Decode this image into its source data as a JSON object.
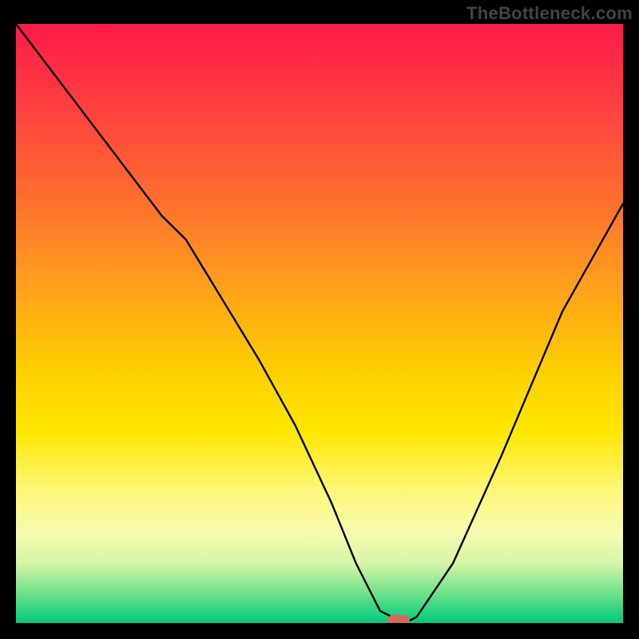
{
  "watermark": "TheBottleneck.com",
  "colors": {
    "background": "#000000",
    "pill": "#d66a5a",
    "curve": "#000000",
    "watermark_text": "#444444"
  },
  "chart_data": {
    "type": "line",
    "title": "",
    "xlabel": "",
    "ylabel": "",
    "xlim": [
      0,
      100
    ],
    "ylim": [
      0,
      100
    ],
    "grid": false,
    "legend": false,
    "series": [
      {
        "name": "bottleneck-curve",
        "x": [
          0,
          6,
          12,
          18,
          24,
          28,
          34,
          40,
          46,
          52,
          56,
          60,
          62,
          64,
          66,
          72,
          80,
          90,
          100
        ],
        "y": [
          100,
          92,
          84,
          76,
          68,
          64,
          54,
          44,
          33,
          20,
          10,
          2,
          1,
          0,
          1,
          10,
          28,
          52,
          70
        ]
      }
    ],
    "marker": {
      "x": 63,
      "y": 0,
      "shape": "pill"
    }
  }
}
